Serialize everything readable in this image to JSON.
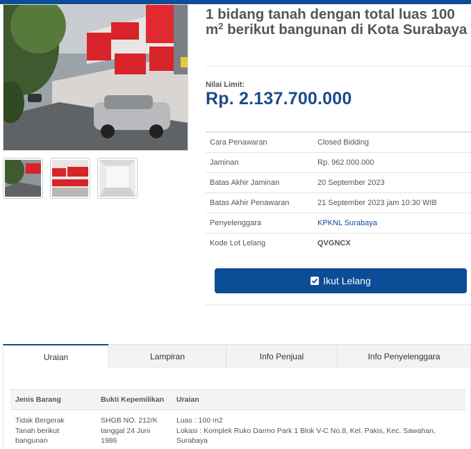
{
  "colors": {
    "primary": "#0b4d96",
    "price": "#1a4c8b"
  },
  "listing": {
    "title_main": "1 bidang tanah dengan total luas 100 m",
    "title_sup": "2",
    "title_rest": " berikut bangunan di Kota Surabaya",
    "limit_label": "Nilai Limit:",
    "limit_value": "Rp. 2.137.700.000"
  },
  "info": [
    {
      "label": "Cara Penawaran",
      "value": "Closed Bidding"
    },
    {
      "label": "Jaminan",
      "value": "Rp. 962.000.000"
    },
    {
      "label": "Batas Akhir Jaminan",
      "value": "20 September 2023"
    },
    {
      "label": "Batas Akhir Penawaran",
      "value": "21 September 2023 jam 10:30 WIB"
    },
    {
      "label": "Penyelenggara",
      "value": "KPKNL Surabaya"
    },
    {
      "label": "Kode Lot Lelang",
      "value": "QVGNCX"
    }
  ],
  "button": {
    "label": "Ikut Lelang",
    "icon": "check-square-icon"
  },
  "tabs": [
    "Uraian",
    "Lampiran",
    "Info Penjual",
    "Info Penyelenggara"
  ],
  "detail": {
    "headers": [
      "Jenis Barang",
      "Bukti Kepemilikan",
      "Uraian"
    ],
    "row": {
      "jenis_lines": [
        "Tidak Bergerak",
        "Tanah berikut",
        "bangunan"
      ],
      "bukti_lines": [
        "SHGB NO. 212/K",
        "tanggal 24 Juni",
        "1986"
      ],
      "uraian_lines": [
        "Luas : 100 m2",
        "Lokasi : Komplek Ruko Darmo Park 1 Blok V-C No.8, Kel. Pakis, Kec. Sawahan,",
        "Surabaya"
      ]
    }
  }
}
